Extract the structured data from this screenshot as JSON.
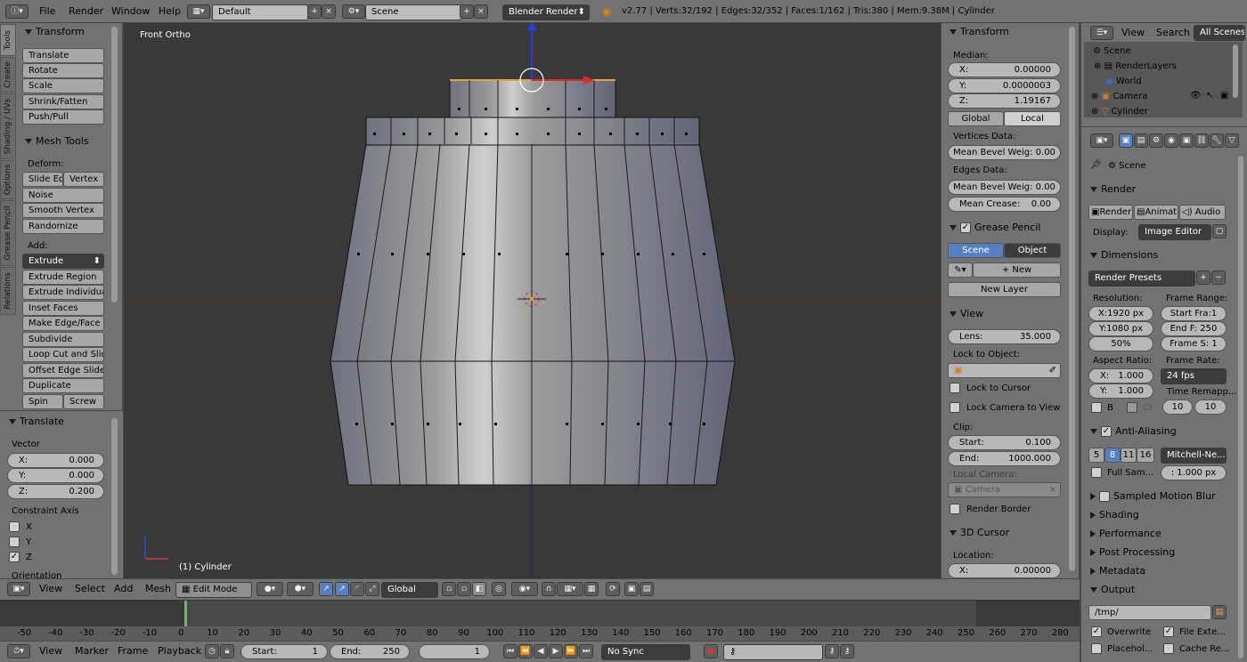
{
  "topbar": {
    "menus": [
      "File",
      "Render",
      "Window",
      "Help"
    ],
    "layout": "Default",
    "scene": "Scene",
    "engine": "Blender Render",
    "stats": "v2.77 | Verts:32/192 | Edges:32/352 | Faces:1/162 | Tris:380 | Mem:9.38M | Cylinder"
  },
  "toolshelf": {
    "tabs": [
      "Tools",
      "Create",
      "Shading / UVs",
      "Options",
      "Grease Pencil",
      "Relations"
    ],
    "transform_title": "Transform",
    "transform_buttons": [
      "Translate",
      "Rotate",
      "Scale",
      "Shrink/Fatten",
      "Push/Pull"
    ],
    "meshtools_title": "Mesh Tools",
    "deform_label": "Deform:",
    "slide_edge": "Slide Ed",
    "vertex": "Vertex",
    "deform_buttons": [
      "Noise",
      "Smooth Vertex",
      "Randomize"
    ],
    "add_label": "Add:",
    "extrude": "Extrude",
    "add_buttons": [
      "Extrude Region",
      "Extrude Individual",
      "Inset Faces",
      "Make Edge/Face",
      "Subdivide",
      "Loop Cut and Slide",
      "Offset Edge Slide",
      "Duplicate"
    ],
    "spin": "Spin",
    "screw": "Screw"
  },
  "operator": {
    "title": "Translate",
    "vector_label": "Vector",
    "x_label": "X:",
    "x": "0.000",
    "y_label": "Y:",
    "y": "0.000",
    "z_label": "Z:",
    "z": "0.200",
    "constraint_label": "Constraint Axis",
    "axes": [
      "X",
      "Y",
      "Z"
    ],
    "orientation_label": "Orientation"
  },
  "viewport": {
    "view_name": "Front Ortho",
    "object_label": "(1) Cylinder"
  },
  "npanel": {
    "transform_title": "Transform",
    "median_label": "Median:",
    "mx_label": "X:",
    "mx": "0.00000",
    "my_label": "Y:",
    "my": "0.0000003",
    "mz_label": "Z:",
    "mz": "1.19167",
    "global": "Global",
    "local": "Local",
    "vertices_data": "Vertices Data:",
    "mean_bevel_v": "Mean Bevel Weig: 0.00",
    "edges_data": "Edges Data:",
    "mean_bevel_e": "Mean Bevel Weig: 0.00",
    "mean_crease_label": "Mean Crease:",
    "mean_crease": "0.00",
    "grease_title": "Grease Pencil",
    "scene_btn": "Scene",
    "object_btn": "Object",
    "new_btn": "New",
    "new_layer": "New Layer",
    "view_title": "View",
    "lens_label": "Lens:",
    "lens": "35.000",
    "lock_object": "Lock to Object:",
    "lock_cursor": "Lock to Cursor",
    "lock_camera": "Lock Camera to View",
    "clip_label": "Clip:",
    "start_label": "Start:",
    "start": "0.100",
    "end_label": "End:",
    "end": "1000.000",
    "local_camera": "Local Camera:",
    "camera": "Camera",
    "render_border": "Render Border",
    "cursor_title": "3D Cursor",
    "location_label": "Location:",
    "cx_label": "X:",
    "cx": "0.00000"
  },
  "view3d_header": {
    "menus": [
      "View",
      "Select",
      "Add",
      "Mesh"
    ],
    "mode": "Edit Mode",
    "orientation": "Global"
  },
  "timeline": {
    "ticks": [
      "-50",
      "-40",
      "-30",
      "-20",
      "-10",
      "0",
      "10",
      "20",
      "30",
      "40",
      "50",
      "60",
      "70",
      "80",
      "90",
      "100",
      "110",
      "120",
      "130",
      "140",
      "150",
      "160",
      "170",
      "180",
      "190",
      "200",
      "210",
      "220",
      "230",
      "240",
      "250",
      "260",
      "270",
      "280"
    ],
    "menus": [
      "View",
      "Marker",
      "Frame",
      "Playback"
    ],
    "start_label": "Start:",
    "start": "1",
    "end_label": "End:",
    "end": "250",
    "current": "1",
    "sync": "No Sync"
  },
  "outliner": {
    "view": "View",
    "search": "Search",
    "all_scenes": "All Scenes",
    "items": [
      "Scene",
      "RenderLayers",
      "World",
      "Camera",
      "Cylinder"
    ]
  },
  "properties": {
    "scene_label": "Scene",
    "render_title": "Render",
    "render_btn": "Render",
    "anim_btn": "Animati",
    "audio_btn": "Audio",
    "display_label": "Display:",
    "display": "Image Editor",
    "dimensions_title": "Dimensions",
    "presets": "Render Presets",
    "resolution_label": "Resolution:",
    "frame_range_label": "Frame Range:",
    "res_x": "X:1920 px",
    "start_frame": "Start Fra:1",
    "res_y": "Y:1080 px",
    "end_frame": "End F: 250",
    "res_pct": "50%",
    "frame_step": "Frame S: 1",
    "aspect_label": "Aspect Ratio:",
    "frame_rate_label": "Frame Rate:",
    "asp_x_label": "X:",
    "asp_x": "1.000",
    "fps": "24 fps",
    "asp_y_label": "Y:",
    "asp_y": "1.000",
    "time_remap": "Time Remapp...",
    "b_label": "B",
    "cr_label": "Cr",
    "remap_old": "10",
    "remap_new": "10",
    "aa_title": "Anti-Aliasing",
    "aa_samples": [
      "5",
      "8",
      "11",
      "16"
    ],
    "aa_filter": "Mitchell-Ne...",
    "full_sample": "Full Sam...",
    "filter_size": ": 1.000 px",
    "motion_blur": "Sampled Motion Blur",
    "shading": "Shading",
    "performance": "Performance",
    "post_processing": "Post Processing",
    "metadata": "Metadata",
    "output_title": "Output",
    "output_path": "/tmp/",
    "overwrite": "Overwrite",
    "file_ext": "File Exte...",
    "placeholders": "Placehol...",
    "cache_result": "Cache Re..."
  },
  "colors": {
    "accent": "#5680c2",
    "viewport_bg": "#393939",
    "panel": "#727272",
    "current_frame": "#56c456"
  }
}
